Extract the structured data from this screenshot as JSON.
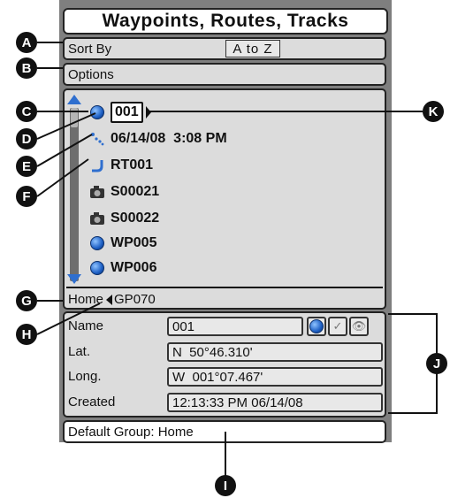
{
  "title": "Waypoints, Routes, Tracks",
  "sort": {
    "label": "Sort By",
    "value": "A to Z"
  },
  "options_label": "Options",
  "list_items": [
    {
      "icon": "waypoint-icon",
      "label": "001",
      "selected": true
    },
    {
      "icon": "track-icon",
      "label": "06/14/08  3:08 PM"
    },
    {
      "icon": "route-icon",
      "label": "RT001"
    },
    {
      "icon": "camera-icon",
      "label": "S00021"
    },
    {
      "icon": "camera-icon",
      "label": "S00022"
    },
    {
      "icon": "waypoint-icon",
      "label": "WP005"
    },
    {
      "icon": "waypoint-icon",
      "label": "WP006"
    }
  ],
  "path": {
    "group": "Home",
    "current": "GP070"
  },
  "details": {
    "name_label": "Name",
    "name_value": "001",
    "lat_label": "Lat.",
    "lat_value": "N  50°46.310'",
    "long_label": "Long.",
    "long_value": "W  001°07.467'",
    "created_label": "Created",
    "created_value": "12:13:33 PM 06/14/08"
  },
  "footer": "Default Group: Home",
  "callouts": [
    "A",
    "B",
    "C",
    "D",
    "E",
    "F",
    "G",
    "H",
    "I",
    "J",
    "K"
  ],
  "colors": {
    "accent": "#2f6fcf",
    "panel": "#7f7f7f",
    "box": "#dcdcdc"
  }
}
